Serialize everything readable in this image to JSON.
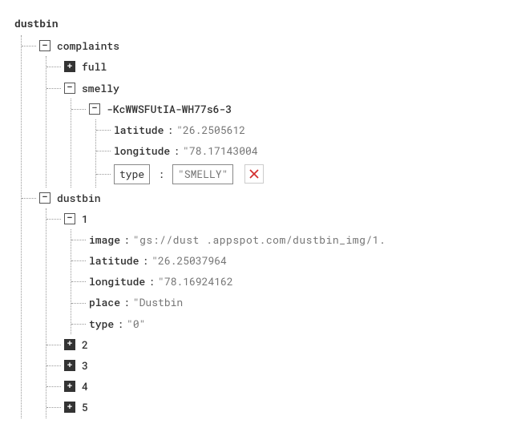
{
  "root": {
    "label": "dustbin"
  },
  "complaints": {
    "label": "complaints",
    "full": {
      "label": "full"
    },
    "smelly": {
      "label": "smelly",
      "entry": {
        "id": "-KcWWSFUtIA-WH77s6-3",
        "latitude": {
          "key": "latitude",
          "value": "\"26.2505612"
        },
        "longitude": {
          "key": "longitude",
          "value": "\"78.17143004"
        },
        "type": {
          "key": "type",
          "value": "\"SMELLY\""
        }
      }
    }
  },
  "dustbin": {
    "label": "dustbin",
    "one": {
      "label": "1",
      "image": {
        "key": "image",
        "value": "\"gs://dust        .appspot.com/dustbin_img/1."
      },
      "latitude": {
        "key": "latitude",
        "value": "\"26.25037964"
      },
      "longitude": {
        "key": "longitude",
        "value": "\"78.16924162"
      },
      "place": {
        "key": "place",
        "value": "\"Dustbin"
      },
      "type": {
        "key": "type",
        "value": "\"0\""
      }
    },
    "two": {
      "label": "2"
    },
    "three": {
      "label": "3"
    },
    "four": {
      "label": "4"
    },
    "five": {
      "label": "5"
    }
  },
  "separator": ":"
}
